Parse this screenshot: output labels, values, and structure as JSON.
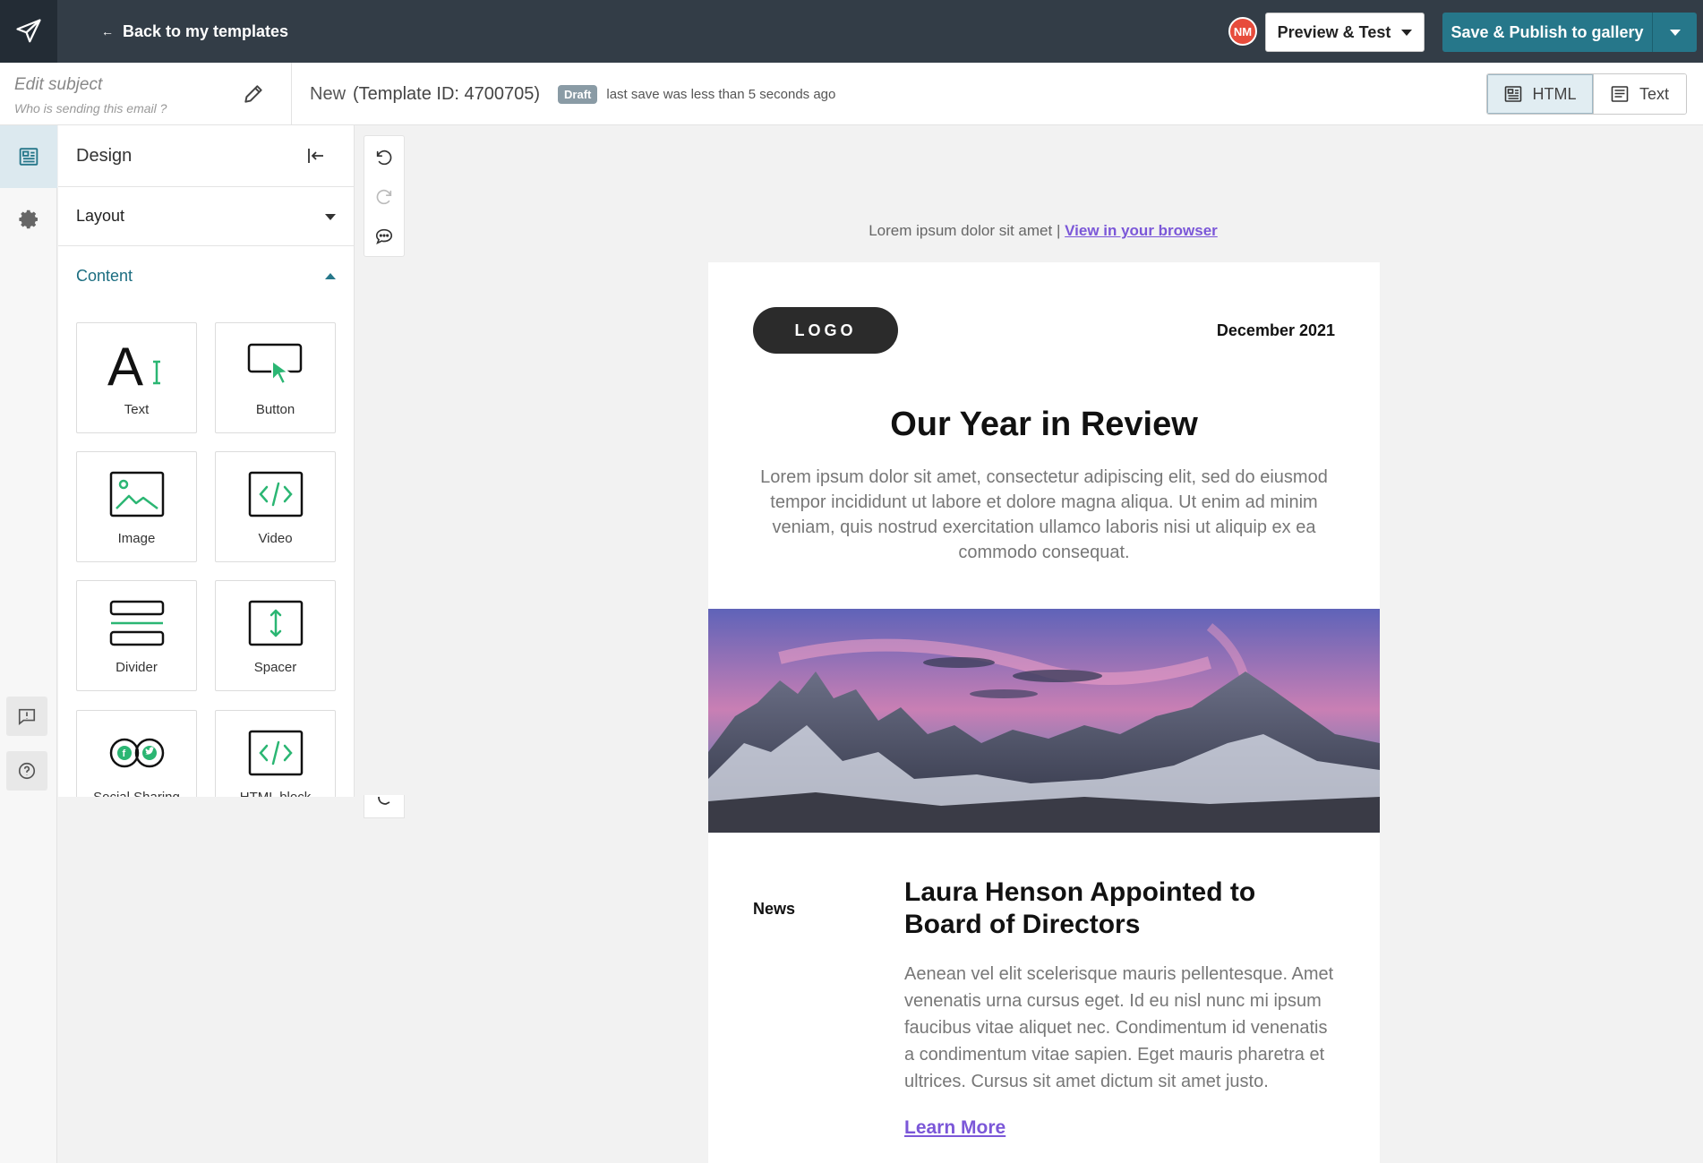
{
  "topbar": {
    "back_label": "Back to my templates",
    "avatar_initials": "NM",
    "preview_label": "Preview & Test",
    "publish_label": "Save & Publish to gallery"
  },
  "subbar": {
    "subject_placeholder": "Edit subject",
    "sender_placeholder": "Who is sending this email ?",
    "template_name": "New",
    "template_id": "(Template ID: 4700705)",
    "status_badge": "Draft",
    "save_status": "last save was less than 5 seconds ago",
    "mode_html": "HTML",
    "mode_text": "Text"
  },
  "panel": {
    "title": "Design",
    "sections": [
      {
        "label": "Layout",
        "open": false
      },
      {
        "label": "Content",
        "open": true
      }
    ],
    "tiles": [
      {
        "label": "Text",
        "icon": "text-icon"
      },
      {
        "label": "Button",
        "icon": "button-icon"
      },
      {
        "label": "Image",
        "icon": "image-icon"
      },
      {
        "label": "Video",
        "icon": "video-icon"
      },
      {
        "label": "Divider",
        "icon": "divider-icon"
      },
      {
        "label": "Spacer",
        "icon": "spacer-icon"
      },
      {
        "label": "Social Sharing",
        "icon": "social-sharing-icon"
      },
      {
        "label": "HTML block",
        "icon": "html-block-icon"
      }
    ]
  },
  "email": {
    "preheader_text": "Lorem ipsum dolor sit amet |",
    "preheader_link": "View in your browser",
    "logo_text": "LOGO",
    "date": "December 2021",
    "title": "Our Year in Review",
    "intro": "Lorem ipsum dolor sit amet, consectetur adipiscing elit, sed do eiusmod tempor incididunt ut labore et dolore magna aliqua. Ut enim ad minim veniam, quis nostrud exercitation ullamco laboris nisi ut aliquip ex ea commodo consequat.",
    "news_tag": "News",
    "news_title": "Laura Henson Appointed to Board of Directors",
    "news_body": "Aenean vel elit scelerisque mauris pellentesque. Amet venenatis urna cursus eget. Id eu nisl nunc mi ipsum faucibus vitae aliquet nec. Condimentum id venenatis a condimentum vitae sapien. Eget mauris pharetra et ultrices. Cursus sit amet dictum sit amet justo.",
    "cta_label": "Learn More"
  },
  "colors": {
    "topbar": "#333d47",
    "accent": "#26778a",
    "link": "#7b57d8",
    "icon_green": "#2bb673"
  }
}
